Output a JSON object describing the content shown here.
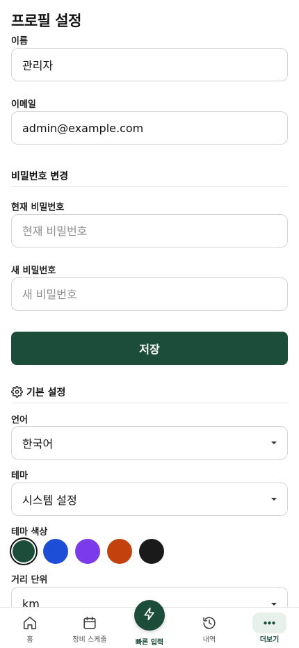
{
  "page": {
    "title": "프로필 설정"
  },
  "profile": {
    "name_label": "이름",
    "name_value": "관리자",
    "email_label": "이메일",
    "email_value": "admin@example.com"
  },
  "password": {
    "section_title": "비밀번호 변경",
    "current_label": "현재 비밀번호",
    "current_placeholder": "현재 비밀번호",
    "new_label": "새 비밀번호",
    "new_placeholder": "새 비밀번호",
    "save_label": "저장"
  },
  "preferences": {
    "section_title": "기본 설정",
    "section_icon": "gear-icon",
    "language_label": "언어",
    "language_value": "한국어",
    "theme_label": "테마",
    "theme_value": "시스템 설정",
    "theme_color_label": "테마 색상",
    "theme_colors": [
      "#1b4d3a",
      "#1d4ed8",
      "#7c3aed",
      "#c2410c",
      "#1a1a1a"
    ],
    "selected_color_index": 0,
    "distance_label": "거리 단위",
    "distance_value": "km"
  },
  "nav": {
    "items": [
      {
        "label": "홈",
        "icon": "home-icon"
      },
      {
        "label": "정비 스케줄",
        "icon": "calendar-icon"
      },
      {
        "label": "빠른 입력",
        "icon": "lightning-icon"
      },
      {
        "label": "내역",
        "icon": "history-icon"
      },
      {
        "label": "더보기",
        "icon": "more-icon"
      }
    ],
    "active_index": 4,
    "accent_color": "#1b4d3a"
  }
}
